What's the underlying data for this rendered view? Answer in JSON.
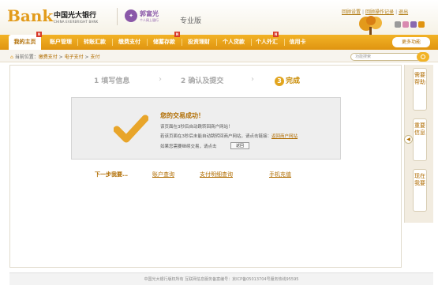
{
  "header": {
    "logo": "Bank",
    "bank_name_cn": "中国光大银行",
    "bank_name_en": "CHINA EVERBRIGHT BANK",
    "partner_name": "郭富光",
    "partner_sub": "个人网上银行",
    "edition": "专业版",
    "links": [
      "回顾设置",
      "回顾操作记录",
      "退出"
    ]
  },
  "nav": {
    "items": [
      {
        "label": "我的主页",
        "active": true,
        "new": true
      },
      {
        "label": "账户管理"
      },
      {
        "label": "转账汇款"
      },
      {
        "label": "缴费支付"
      },
      {
        "label": "储蓄存款",
        "new": true
      },
      {
        "label": "投资理财"
      },
      {
        "label": "个人贷款"
      },
      {
        "label": "个人外汇",
        "new": true
      },
      {
        "label": "信用卡"
      }
    ],
    "more": "更多功能"
  },
  "breadcrumb": {
    "prefix": "当前位置：",
    "items": [
      "缴费支付",
      "电子支付",
      "支付"
    ],
    "sep": " > "
  },
  "search": {
    "placeholder": "功能搜索"
  },
  "steps": [
    {
      "label": "1 填写信息"
    },
    {
      "label": "2 确认及提交"
    },
    {
      "num": "3",
      "label": "完成"
    }
  ],
  "result": {
    "title": "您的交易成功！",
    "line1": "该页面在3秒后自动跳转回商户网站！",
    "line2": "若该页面在3秒后未能自动跳转回商户网站，请点击链接：",
    "line2_link": "返回商户网站",
    "line3": "如果您需要继续交易，请点击",
    "back": "返回"
  },
  "next": {
    "label": "下一步我要…",
    "links": [
      "账户查询",
      "支付明细查询",
      "手机充值"
    ]
  },
  "side": {
    "arrow": "◀",
    "tabs": [
      "需要帮助",
      "重要信息",
      "现在我要"
    ]
  },
  "footer": "中国光大银行版权所有  互联网信息服务备案编号：京ICP备05013704号服务热线95595",
  "colors": {
    "accent": "#e09410",
    "link": "#b06c00"
  }
}
